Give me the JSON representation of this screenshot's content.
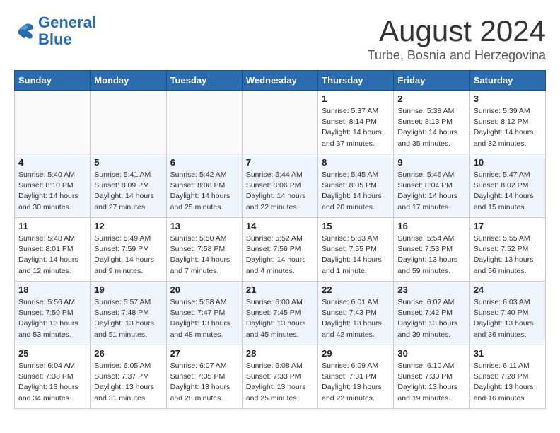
{
  "header": {
    "logo_line1": "General",
    "logo_line2": "Blue",
    "month_year": "August 2024",
    "location": "Turbe, Bosnia and Herzegovina"
  },
  "weekdays": [
    "Sunday",
    "Monday",
    "Tuesday",
    "Wednesday",
    "Thursday",
    "Friday",
    "Saturday"
  ],
  "weeks": [
    [
      {
        "day": "",
        "info": ""
      },
      {
        "day": "",
        "info": ""
      },
      {
        "day": "",
        "info": ""
      },
      {
        "day": "",
        "info": ""
      },
      {
        "day": "1",
        "info": "Sunrise: 5:37 AM\nSunset: 8:14 PM\nDaylight: 14 hours\nand 37 minutes."
      },
      {
        "day": "2",
        "info": "Sunrise: 5:38 AM\nSunset: 8:13 PM\nDaylight: 14 hours\nand 35 minutes."
      },
      {
        "day": "3",
        "info": "Sunrise: 5:39 AM\nSunset: 8:12 PM\nDaylight: 14 hours\nand 32 minutes."
      }
    ],
    [
      {
        "day": "4",
        "info": "Sunrise: 5:40 AM\nSunset: 8:10 PM\nDaylight: 14 hours\nand 30 minutes."
      },
      {
        "day": "5",
        "info": "Sunrise: 5:41 AM\nSunset: 8:09 PM\nDaylight: 14 hours\nand 27 minutes."
      },
      {
        "day": "6",
        "info": "Sunrise: 5:42 AM\nSunset: 8:08 PM\nDaylight: 14 hours\nand 25 minutes."
      },
      {
        "day": "7",
        "info": "Sunrise: 5:44 AM\nSunset: 8:06 PM\nDaylight: 14 hours\nand 22 minutes."
      },
      {
        "day": "8",
        "info": "Sunrise: 5:45 AM\nSunset: 8:05 PM\nDaylight: 14 hours\nand 20 minutes."
      },
      {
        "day": "9",
        "info": "Sunrise: 5:46 AM\nSunset: 8:04 PM\nDaylight: 14 hours\nand 17 minutes."
      },
      {
        "day": "10",
        "info": "Sunrise: 5:47 AM\nSunset: 8:02 PM\nDaylight: 14 hours\nand 15 minutes."
      }
    ],
    [
      {
        "day": "11",
        "info": "Sunrise: 5:48 AM\nSunset: 8:01 PM\nDaylight: 14 hours\nand 12 minutes."
      },
      {
        "day": "12",
        "info": "Sunrise: 5:49 AM\nSunset: 7:59 PM\nDaylight: 14 hours\nand 9 minutes."
      },
      {
        "day": "13",
        "info": "Sunrise: 5:50 AM\nSunset: 7:58 PM\nDaylight: 14 hours\nand 7 minutes."
      },
      {
        "day": "14",
        "info": "Sunrise: 5:52 AM\nSunset: 7:56 PM\nDaylight: 14 hours\nand 4 minutes."
      },
      {
        "day": "15",
        "info": "Sunrise: 5:53 AM\nSunset: 7:55 PM\nDaylight: 14 hours\nand 1 minute."
      },
      {
        "day": "16",
        "info": "Sunrise: 5:54 AM\nSunset: 7:53 PM\nDaylight: 13 hours\nand 59 minutes."
      },
      {
        "day": "17",
        "info": "Sunrise: 5:55 AM\nSunset: 7:52 PM\nDaylight: 13 hours\nand 56 minutes."
      }
    ],
    [
      {
        "day": "18",
        "info": "Sunrise: 5:56 AM\nSunset: 7:50 PM\nDaylight: 13 hours\nand 53 minutes."
      },
      {
        "day": "19",
        "info": "Sunrise: 5:57 AM\nSunset: 7:48 PM\nDaylight: 13 hours\nand 51 minutes."
      },
      {
        "day": "20",
        "info": "Sunrise: 5:58 AM\nSunset: 7:47 PM\nDaylight: 13 hours\nand 48 minutes."
      },
      {
        "day": "21",
        "info": "Sunrise: 6:00 AM\nSunset: 7:45 PM\nDaylight: 13 hours\nand 45 minutes."
      },
      {
        "day": "22",
        "info": "Sunrise: 6:01 AM\nSunset: 7:43 PM\nDaylight: 13 hours\nand 42 minutes."
      },
      {
        "day": "23",
        "info": "Sunrise: 6:02 AM\nSunset: 7:42 PM\nDaylight: 13 hours\nand 39 minutes."
      },
      {
        "day": "24",
        "info": "Sunrise: 6:03 AM\nSunset: 7:40 PM\nDaylight: 13 hours\nand 36 minutes."
      }
    ],
    [
      {
        "day": "25",
        "info": "Sunrise: 6:04 AM\nSunset: 7:38 PM\nDaylight: 13 hours\nand 34 minutes."
      },
      {
        "day": "26",
        "info": "Sunrise: 6:05 AM\nSunset: 7:37 PM\nDaylight: 13 hours\nand 31 minutes."
      },
      {
        "day": "27",
        "info": "Sunrise: 6:07 AM\nSunset: 7:35 PM\nDaylight: 13 hours\nand 28 minutes."
      },
      {
        "day": "28",
        "info": "Sunrise: 6:08 AM\nSunset: 7:33 PM\nDaylight: 13 hours\nand 25 minutes."
      },
      {
        "day": "29",
        "info": "Sunrise: 6:09 AM\nSunset: 7:31 PM\nDaylight: 13 hours\nand 22 minutes."
      },
      {
        "day": "30",
        "info": "Sunrise: 6:10 AM\nSunset: 7:30 PM\nDaylight: 13 hours\nand 19 minutes."
      },
      {
        "day": "31",
        "info": "Sunrise: 6:11 AM\nSunset: 7:28 PM\nDaylight: 13 hours\nand 16 minutes."
      }
    ]
  ]
}
